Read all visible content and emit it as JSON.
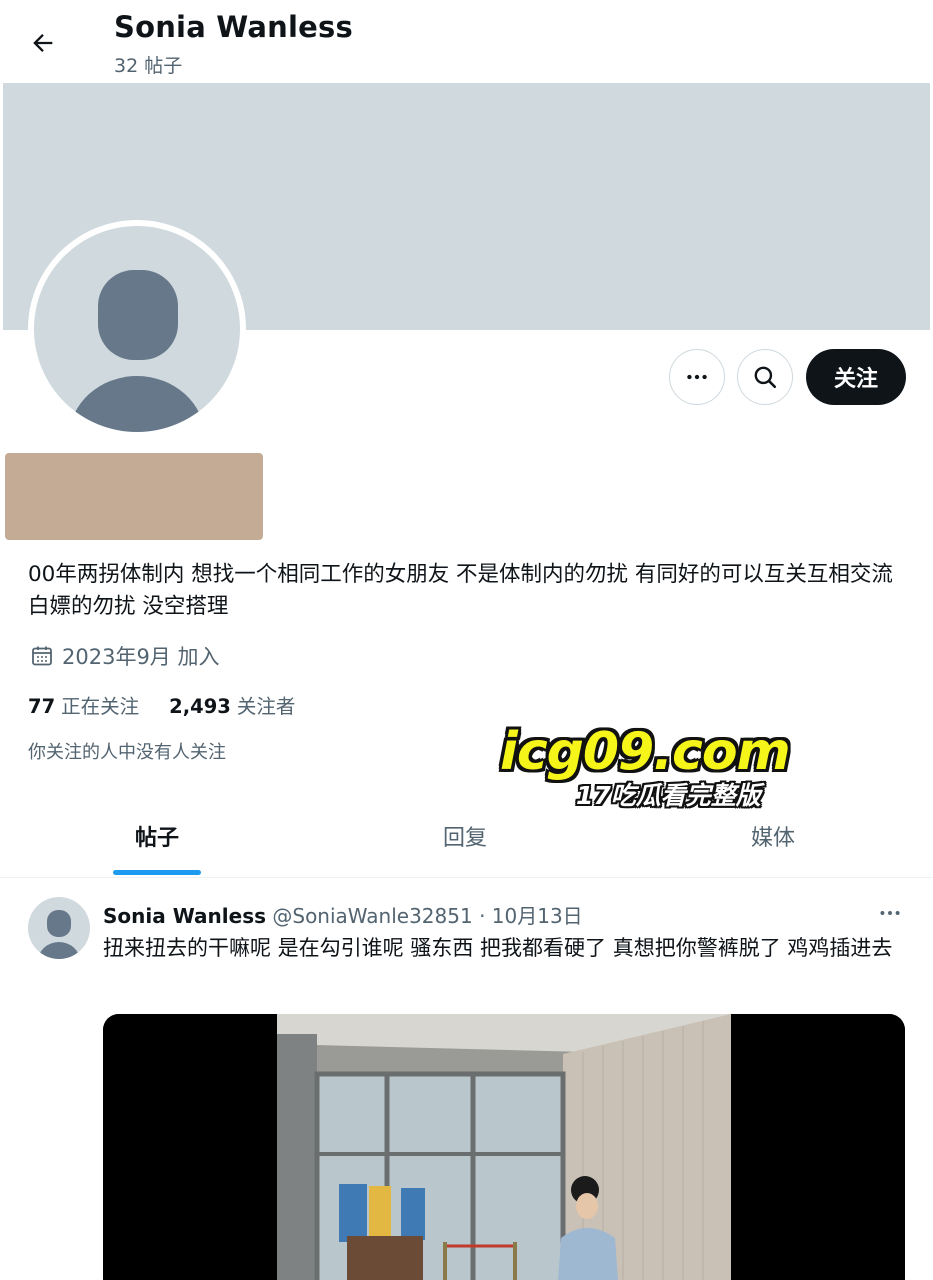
{
  "header": {
    "name": "Sonia Wanless",
    "post_count": "32 帖子"
  },
  "profile": {
    "follow_label": "关注",
    "bio": "00年两拐体制内 想找一个相同工作的女朋友 不是体制内的勿扰 有同好的可以互关互相交流 白嫖的勿扰 没空搭理",
    "joined": "2023年9月 加入",
    "following_count": "77",
    "following_label": "正在关注",
    "followers_count": "2,493",
    "followers_label": "关注者",
    "mutual_note": "你关注的人中没有人关注"
  },
  "watermark": {
    "main": "icg09.com",
    "sub": "17吃瓜看完整版"
  },
  "tabs": [
    {
      "label": "帖子",
      "active": true
    },
    {
      "label": "回复",
      "active": false
    },
    {
      "label": "媒体",
      "active": false
    }
  ],
  "post": {
    "name": "Sonia Wanless",
    "handle_date": "@SoniaWanle32851 · 10月13日",
    "text": "扭来扭去的干嘛呢 是在勾引谁呢 骚东西 把我都看硬了 真想把你警裤脱了 鸡鸡插进去"
  },
  "colors": {
    "accent": "#1d9bf0",
    "banner": "#cfd9de",
    "secondary_text": "#536471",
    "redaction": "#c4ab95"
  },
  "icons": [
    "back-arrow-icon",
    "more-icon",
    "search-icon",
    "calendar-icon",
    "default-avatar-icon"
  ]
}
